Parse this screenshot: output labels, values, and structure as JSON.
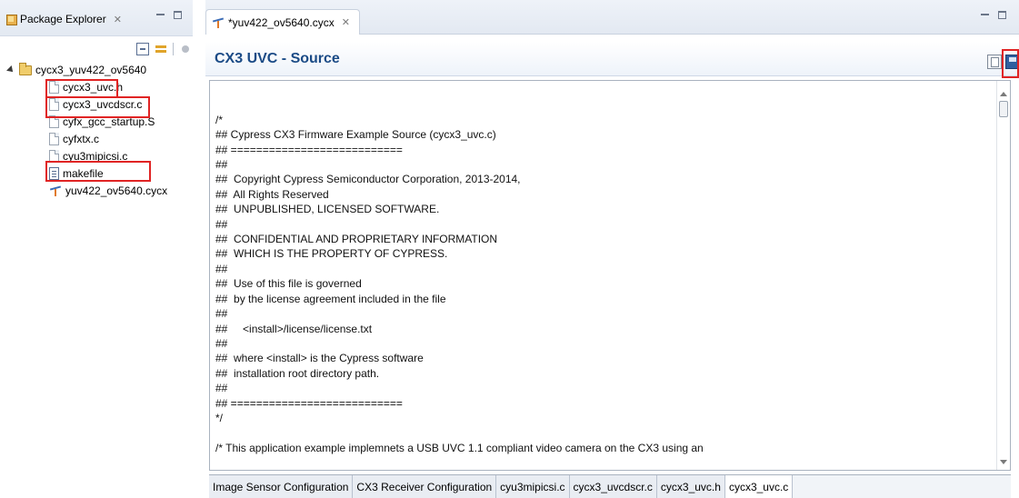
{
  "package_explorer": {
    "tab_label": "Package Explorer",
    "close_glyph": "✕",
    "toolbar_icons": [
      "collapse-all-icon",
      "link-with-editor-icon",
      "bean-icon",
      "view-menu-icon"
    ],
    "tree": [
      {
        "label": "cycx3_yuv422_ov5640",
        "icon": "folder-icon",
        "level": 0,
        "expanded": true
      },
      {
        "label": "cycx3_uvc.h",
        "icon": "file-icon",
        "level": 1,
        "highlighted": true
      },
      {
        "label": "cycx3_uvcdscr.c",
        "icon": "file-icon",
        "level": 1,
        "highlighted": true
      },
      {
        "label": "cyfx_gcc_startup.S",
        "icon": "file-icon",
        "level": 1
      },
      {
        "label": "cyfxtx.c",
        "icon": "file-icon",
        "level": 1
      },
      {
        "label": "cyu3mipicsi.c",
        "icon": "file-icon",
        "level": 1,
        "highlighted": true
      },
      {
        "label": "makefile",
        "icon": "makefile-icon",
        "level": 1
      },
      {
        "label": "yuv422_ov5640.cycx",
        "icon": "cycx-config-icon",
        "level": 1
      }
    ]
  },
  "editor": {
    "tab_label": "*yuv422_ov5640.cycx",
    "close_glyph": "✕",
    "header_title": "CX3 UVC - Source",
    "header_icons": [
      "copy-icon",
      "save-icon"
    ],
    "highlight_color": "#e02424",
    "title_color": "#1b4b86",
    "source_lines": [
      "",
      "",
      "/*",
      "## Cypress CX3 Firmware Example Source (cycx3_uvc.c)",
      "## ===========================",
      "##",
      "##  Copyright Cypress Semiconductor Corporation, 2013-2014,",
      "##  All Rights Reserved",
      "##  UNPUBLISHED, LICENSED SOFTWARE.",
      "##",
      "##  CONFIDENTIAL AND PROPRIETARY INFORMATION",
      "##  WHICH IS THE PROPERTY OF CYPRESS.",
      "##",
      "##  Use of this file is governed",
      "##  by the license agreement included in the file",
      "##",
      "##     <install>/license/license.txt",
      "##",
      "##  where <install> is the Cypress software",
      "##  installation root directory path.",
      "##",
      "## ===========================",
      "*/",
      "",
      "/* This application example implemnets a USB UVC 1.1 compliant video camera on the CX3 using an"
    ],
    "bottom_tabs": [
      {
        "label": "Image Sensor Configuration",
        "active": false
      },
      {
        "label": "CX3 Receiver Configuration",
        "active": false
      },
      {
        "label": "cyu3mipicsi.c",
        "active": false
      },
      {
        "label": "cycx3_uvcdscr.c",
        "active": false
      },
      {
        "label": "cycx3_uvc.h",
        "active": false
      },
      {
        "label": "cycx3_uvc.c",
        "active": true
      }
    ]
  }
}
